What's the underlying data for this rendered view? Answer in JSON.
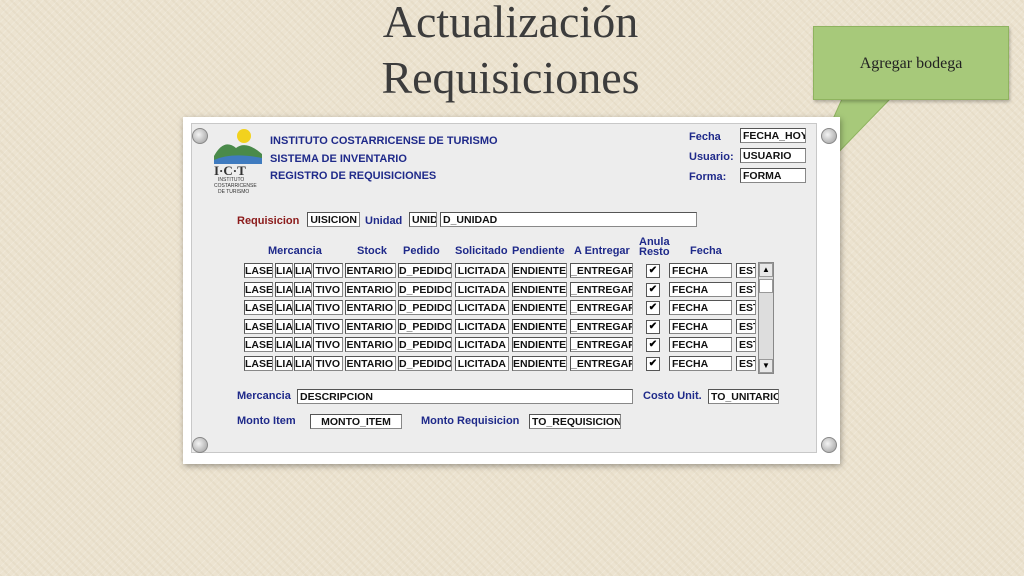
{
  "slide": {
    "title_line1": "Actualización",
    "title_line2": "Requisiciones"
  },
  "callout": {
    "text": "Agregar bodega"
  },
  "header": {
    "org": "INSTITUTO COSTARRICENSE DE TURISMO",
    "system": "SISTEMA DE INVENTARIO",
    "module": "REGISTRO DE REQUISICIONES",
    "logo_text": "I·C·T",
    "logo_sub1": "INSTITUTO",
    "logo_sub2": "COSTARRICENSE",
    "logo_sub3": "DE TURISMO"
  },
  "meta": {
    "fecha_label": "Fecha",
    "fecha_value": "FECHA_HOY",
    "usuario_label": "Usuario:",
    "usuario_value": "USUARIO",
    "forma_label": "Forma:",
    "forma_value": "FORMA"
  },
  "requisicion": {
    "label": "Requisicion",
    "value": "UISICION",
    "unidad_label": "Unidad",
    "unidad_code": "UNID",
    "unidad_desc": "D_UNIDAD"
  },
  "table": {
    "headers": {
      "mercancia": "Mercancia",
      "stock": "Stock",
      "pedido": "Pedido",
      "solicitado": "Solicitado",
      "pendiente": "Pendiente",
      "a_entregar": "A Entregar",
      "anula1": "Anula",
      "anula2": "Resto",
      "fecha": "Fecha"
    },
    "rows": [
      {
        "c1": "LASE",
        "c2": "LIA",
        "c3": "LIA",
        "c4": "TIVO",
        "stock": "ENTARIO",
        "pedido": "D_PEDIDO",
        "solicitado": "LICITADA",
        "pendiente": "ENDIENTE",
        "entregar": "_ENTREGAR",
        "anula": "✔",
        "fecha": "FECHA",
        "est": "EST"
      },
      {
        "c1": "LASE",
        "c2": "LIA",
        "c3": "LIA",
        "c4": "TIVO",
        "stock": "ENTARIO",
        "pedido": "D_PEDIDO",
        "solicitado": "LICITADA",
        "pendiente": "ENDIENTE",
        "entregar": "_ENTREGAR",
        "anula": "✔",
        "fecha": "FECHA",
        "est": "EST"
      },
      {
        "c1": "LASE",
        "c2": "LIA",
        "c3": "LIA",
        "c4": "TIVO",
        "stock": "ENTARIO",
        "pedido": "D_PEDIDO",
        "solicitado": "LICITADA",
        "pendiente": "ENDIENTE",
        "entregar": "_ENTREGAR",
        "anula": "✔",
        "fecha": "FECHA",
        "est": "EST"
      },
      {
        "c1": "LASE",
        "c2": "LIA",
        "c3": "LIA",
        "c4": "TIVO",
        "stock": "ENTARIO",
        "pedido": "D_PEDIDO",
        "solicitado": "LICITADA",
        "pendiente": "ENDIENTE",
        "entregar": "_ENTREGAR",
        "anula": "✔",
        "fecha": "FECHA",
        "est": "EST"
      },
      {
        "c1": "LASE",
        "c2": "LIA",
        "c3": "LIA",
        "c4": "TIVO",
        "stock": "ENTARIO",
        "pedido": "D_PEDIDO",
        "solicitado": "LICITADA",
        "pendiente": "ENDIENTE",
        "entregar": "_ENTREGAR",
        "anula": "✔",
        "fecha": "FECHA",
        "est": "EST"
      },
      {
        "c1": "LASE",
        "c2": "LIA",
        "c3": "LIA",
        "c4": "TIVO",
        "stock": "ENTARIO",
        "pedido": "D_PEDIDO",
        "solicitado": "LICITADA",
        "pendiente": "ENDIENTE",
        "entregar": "_ENTREGAR",
        "anula": "✔",
        "fecha": "FECHA",
        "est": "EST"
      }
    ]
  },
  "footer": {
    "mercancia_label": "Mercancia",
    "mercancia_value": "DESCRIPCION",
    "costo_label": "Costo Unit.",
    "costo_value": "TO_UNITARIO",
    "monto_item_label": "Monto Item",
    "monto_item_value": "MONTO_ITEM",
    "monto_req_label": "Monto Requisicion",
    "monto_req_value": "TO_REQUISICION"
  },
  "scrollbar": {
    "up_icon": "▲",
    "down_icon": "▼"
  }
}
